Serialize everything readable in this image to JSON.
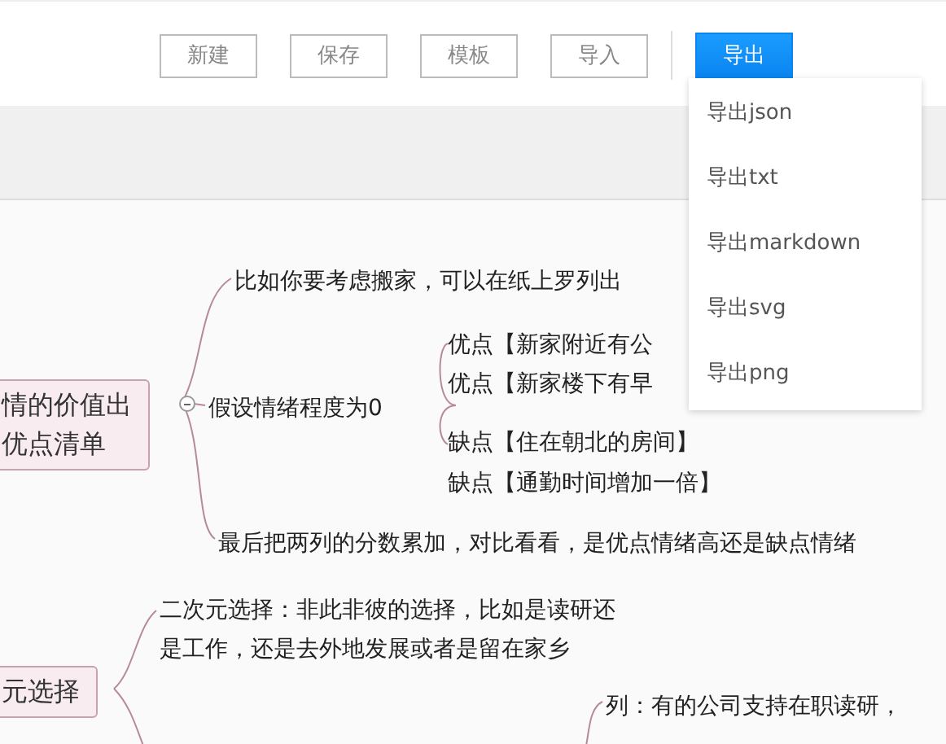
{
  "toolbar": {
    "buttons": [
      {
        "label": "新建",
        "selected": false
      },
      {
        "label": "保存",
        "selected": false
      },
      {
        "label": "模板",
        "selected": false
      },
      {
        "label": "导入",
        "selected": false
      },
      {
        "label": "导出",
        "selected": true
      }
    ]
  },
  "export_menu": {
    "items": [
      "导出json",
      "导出txt",
      "导出markdown",
      "导出svg",
      "导出png"
    ]
  },
  "mindmap": {
    "nodes": [
      {
        "kind": "topic",
        "lines": [
          "情的价值出",
          "优点清单"
        ]
      },
      {
        "kind": "text",
        "lines": [
          "比如你要考虑搬家，可以在纸上罗列出"
        ]
      },
      {
        "kind": "text",
        "lines": [
          "假设情绪程度为0"
        ]
      },
      {
        "kind": "text",
        "lines": [
          "优点【新家附近有公"
        ]
      },
      {
        "kind": "text",
        "lines": [
          "优点【新家楼下有早"
        ]
      },
      {
        "kind": "text",
        "lines": [
          "缺点【住在朝北的房间】"
        ]
      },
      {
        "kind": "text",
        "lines": [
          "缺点【通勤时间增加一倍】"
        ]
      },
      {
        "kind": "text",
        "lines": [
          "最后把两列的分数累加，对比看看，是优点情绪高还是缺点情绪"
        ]
      },
      {
        "kind": "text",
        "lines": [
          "二次元选择：非此非彼的选择，比如是读研还",
          "是工作，还是去外地发展或者是留在家乡"
        ]
      },
      {
        "kind": "topic",
        "lines": [
          "元选择"
        ]
      },
      {
        "kind": "text",
        "lines": [
          "列：有的公司支持在职读研，"
        ]
      }
    ]
  }
}
